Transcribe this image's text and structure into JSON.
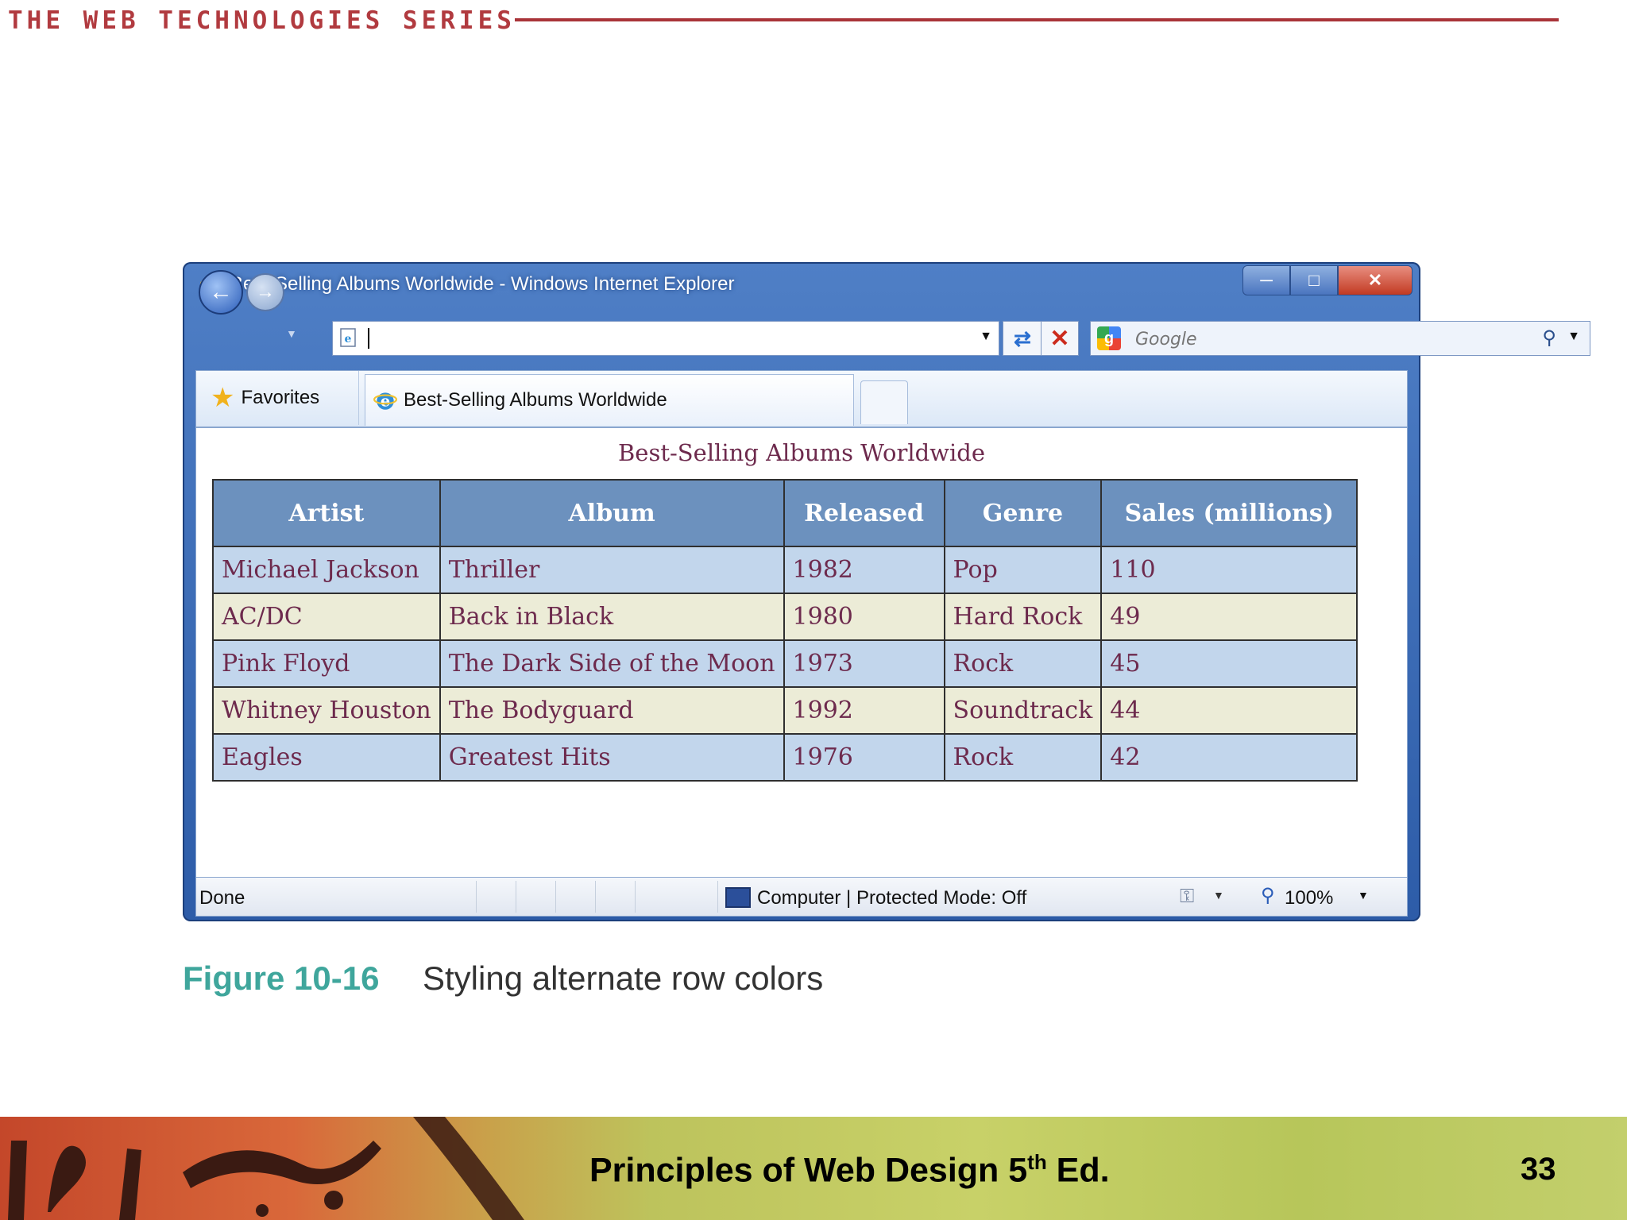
{
  "slide": {
    "series_title": "THE WEB TECHNOLOGIES SERIES",
    "caption_figure": "Figure 10-16",
    "caption_text": "Styling alternate row colors",
    "footer_title": "Principles of Web Design 5",
    "footer_title_sup": "th",
    "footer_title_end": " Ed.",
    "page_number": "33"
  },
  "browser": {
    "window_title": "Best-Selling Albums Worldwide - Windows Internet Explorer",
    "address_value": "",
    "search_placeholder": "Google",
    "favorites_label": "Favorites",
    "tab_label": "Best-Selling Albums Worldwide",
    "status_done": "Done",
    "status_zone": "Computer | Protected Mode: Off",
    "zoom": "100%",
    "icons": [
      "ie-logo-icon",
      "minimize-icon",
      "maximize-icon",
      "close-icon",
      "back-arrow-icon",
      "forward-arrow-icon",
      "page-icon",
      "refresh-icon",
      "stop-icon",
      "google-icon",
      "search-icon",
      "star-icon",
      "computer-icon",
      "lock-icon",
      "zoom-icon"
    ]
  },
  "page": {
    "heading": "Best-Selling Albums Worldwide",
    "columns": [
      "Artist",
      "Album",
      "Released",
      "Genre",
      "Sales (millions)"
    ],
    "rows": [
      [
        "Michael Jackson",
        "Thriller",
        "1982",
        "Pop",
        "110"
      ],
      [
        "AC/DC",
        "Back in Black",
        "1980",
        "Hard Rock",
        "49"
      ],
      [
        "Pink Floyd",
        "The Dark Side of the Moon",
        "1973",
        "Rock",
        "45"
      ],
      [
        "Whitney Houston",
        "The Bodyguard",
        "1992",
        "Soundtrack",
        "44"
      ],
      [
        "Eagles",
        "Greatest Hits",
        "1976",
        "Rock",
        "42"
      ]
    ],
    "colors": {
      "header_bg": "#6c91be",
      "odd_row_bg": "#c2d6ec",
      "even_row_bg": "#ececd7",
      "text": "#6d2a4d"
    }
  }
}
